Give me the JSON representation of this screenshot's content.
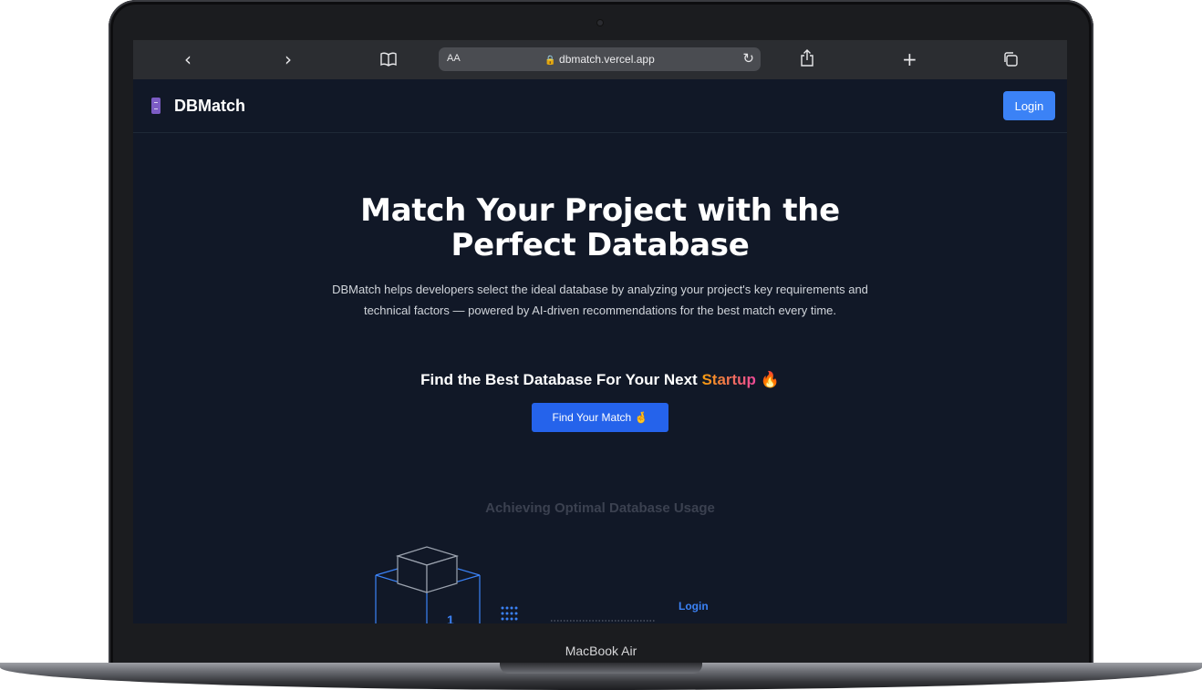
{
  "device": {
    "model_label": "MacBook Air"
  },
  "browser": {
    "back_icon": "chevron-left-icon",
    "forward_icon": "chevron-right-icon",
    "reader_aa": "AA",
    "url": "dbmatch.vercel.app",
    "lock_icon": "lock-icon",
    "reload_icon": "reload-icon",
    "share_icon": "share-icon",
    "new_tab_icon": "plus-icon",
    "tabs_icon": "tabs-icon"
  },
  "navbar": {
    "brand": "DBMatch",
    "login_label": "Login"
  },
  "hero": {
    "title_line1": "Match Your Project with the",
    "title_line2": "Perfect Database",
    "description": "DBMatch helps developers select the ideal database by analyzing your project's key requirements and technical factors — powered by AI-driven recommendations for the best match every time.",
    "tagline_prefix": "Find the Best Database For Your Next",
    "tagline_accent": "Startup",
    "tagline_emoji": "🔥",
    "cta_label": "Find Your Match 🤞"
  },
  "section": {
    "title": "Achieving Optimal Database Usage",
    "illustration_label": "Login",
    "illustration_number": "1"
  },
  "colors": {
    "page_bg": "#111827",
    "accent_blue": "#3b82f6",
    "cta_blue": "#2563eb",
    "gradient_start": "#f59e0b",
    "gradient_end": "#ec4899"
  }
}
